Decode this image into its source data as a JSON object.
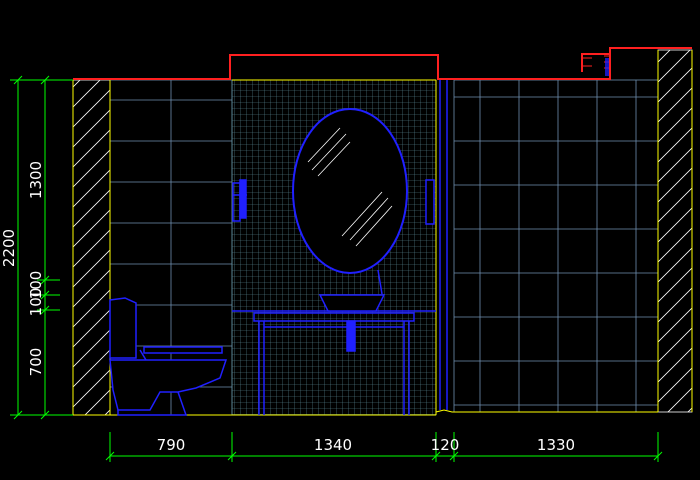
{
  "drawing": {
    "colors": {
      "background": "#000000",
      "dimension": "#00ff00",
      "tile_grid": "#6f8fb0",
      "mosaic": "#5e8f9c",
      "wall_outline": "#ffff00",
      "ceiling": "#ff2020",
      "fixture": "#2020ff",
      "hatch": "#ffffff"
    },
    "horizontal_dimensions": [
      "790",
      "1340",
      "120",
      "1330"
    ],
    "vertical_dimensions": {
      "overall": "2200",
      "upper": "1300",
      "middle_a": "100",
      "middle_b": "100",
      "lower": "700"
    }
  }
}
